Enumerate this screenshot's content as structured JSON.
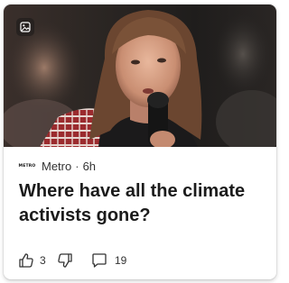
{
  "card": {
    "source": {
      "logo_text": "METRO",
      "name": "Metro",
      "separator": "·",
      "age": "6h"
    },
    "headline": "Where have all the climate activists gone?",
    "image": {
      "icon": "gallery-icon"
    },
    "actions": {
      "like": {
        "icon": "thumbs-up-icon",
        "count": "3"
      },
      "dislike": {
        "icon": "thumbs-down-icon"
      },
      "comments": {
        "icon": "comment-icon",
        "count": "19"
      }
    }
  }
}
